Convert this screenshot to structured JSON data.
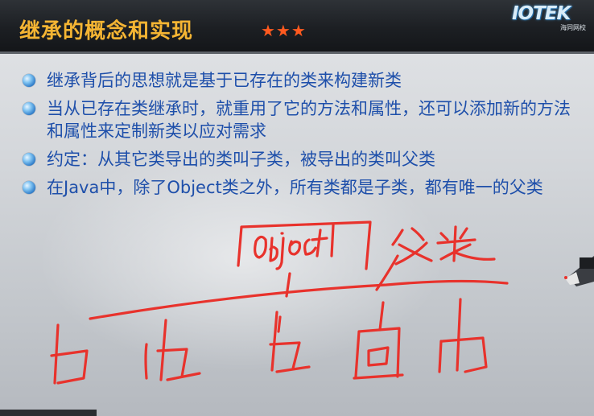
{
  "slide": {
    "title": "继承的概念和实现",
    "stars": "★★★",
    "logo": {
      "name": "IOTEK",
      "sub": "海同网校"
    },
    "bullets": [
      "继承背后的思想就是基于已存在的类来构建新类",
      "当从已存在类继承时，就重用了它的方法和属性，还可以添加新的方法和属性来定制新类以应对需求",
      "约定：从其它类导出的类叫子类，被导出的类叫父类",
      "在Java中，除了Object类之外，所有类都是子类，都有唯一的父类"
    ]
  },
  "annotation": {
    "stroke_color": "#e8322c",
    "handwritten_text": [
      "Object",
      "父类"
    ]
  },
  "colors": {
    "title": "#f5b533",
    "stars": "#ff5a1f",
    "bullet_text": "#1e4faa"
  }
}
